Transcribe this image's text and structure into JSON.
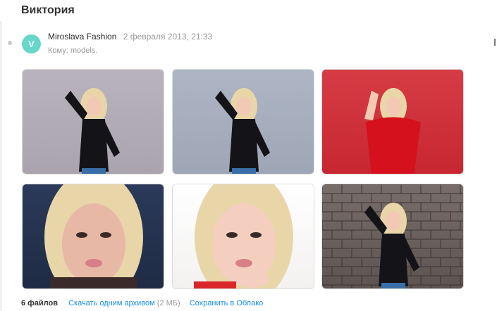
{
  "message": {
    "subject": "Виктория",
    "avatar_letter": "V",
    "sender": "Miroslava Fashion",
    "date": "2 февраля 2013, 21:33",
    "recipient": "Кому: models."
  },
  "attachments": {
    "photos": [
      {
        "name": "photo-1",
        "bg": "#a9a4ad",
        "top": "#b8b3bc",
        "outfit": "black",
        "pose": "arm-up"
      },
      {
        "name": "photo-2",
        "bg": "#9ea6b6",
        "top": "#aeb5c4",
        "outfit": "black",
        "pose": "arm-up"
      },
      {
        "name": "photo-3",
        "bg": "#c72630",
        "top": "#d63c45",
        "outfit": "red",
        "pose": "red-dress"
      },
      {
        "name": "photo-4",
        "bg": "#1f2b44",
        "top": "#2b3a5a",
        "outfit": "face",
        "pose": "closeup"
      },
      {
        "name": "photo-5",
        "bg": "#f3f1f0",
        "top": "#ffffff",
        "outfit": "face-light",
        "pose": "closeup-hand"
      },
      {
        "name": "photo-6",
        "bg": "#5d5350",
        "top": "#786d69",
        "outfit": "black",
        "pose": "brick"
      }
    ],
    "files_count": "6 файлов",
    "download_label": "Скачать одним архивом",
    "download_size": "(2 МБ)",
    "save_label": "Сохранить в Облако"
  },
  "colors": {
    "link": "#168de2",
    "avatar": "#66d7c9",
    "muted": "#999999"
  }
}
